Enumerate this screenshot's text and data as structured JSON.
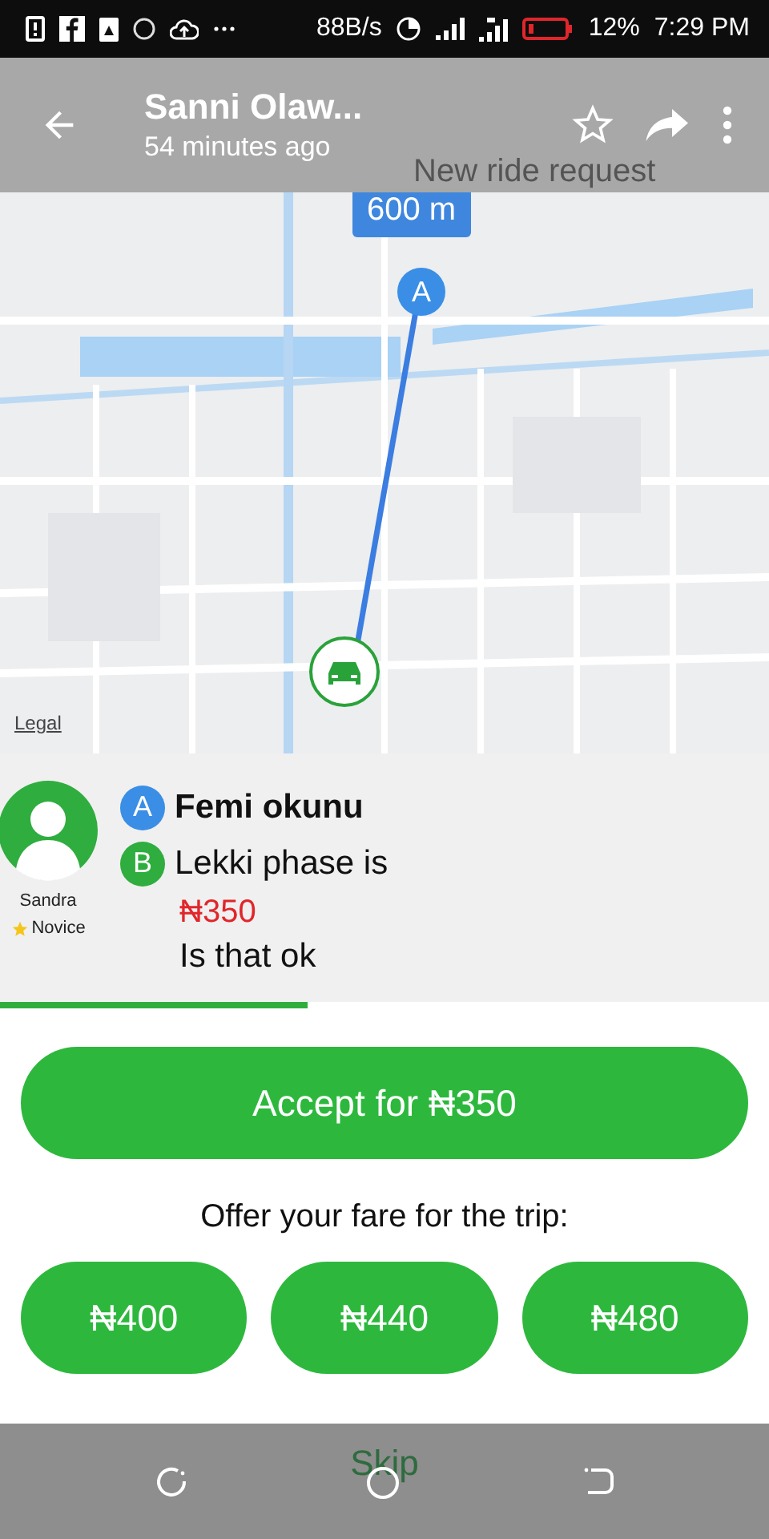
{
  "status_bar": {
    "speed": "88B/s",
    "battery": "12%",
    "time": "7:29 PM"
  },
  "app_bar": {
    "title": "Sanni Olaw...",
    "subtitle": "54 minutes ago"
  },
  "page_title": "New ride request",
  "map": {
    "distance": "600 m",
    "pickup_marker": "A",
    "legal": "Legal"
  },
  "rider": {
    "name": "Sandra",
    "rank": "Novice"
  },
  "stops": [
    {
      "kind": "pickup",
      "marker": "A",
      "text": "Femi okunu",
      "color": "#3a8ee6"
    },
    {
      "kind": "dropoff",
      "marker": "B",
      "text": "Lekki phase is",
      "color": "#2fad3e"
    }
  ],
  "price": "₦350",
  "note": "Is that ok",
  "timer": {
    "level": 0.4
  },
  "accept_button": "Accept for ₦350",
  "offer_label": "Offer your fare for the trip:",
  "fares": [
    "₦400",
    "₦440",
    "₦480"
  ],
  "skip": "Skip"
}
